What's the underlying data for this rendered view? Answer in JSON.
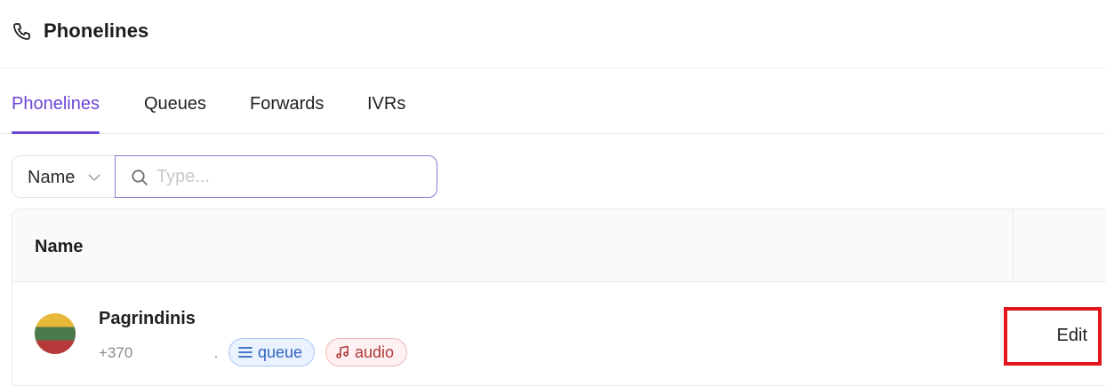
{
  "header": {
    "title": "Phonelines",
    "icon": "phone-icon"
  },
  "tabs": [
    {
      "label": "Phonelines",
      "active": true
    },
    {
      "label": "Queues",
      "active": false
    },
    {
      "label": "Forwards",
      "active": false
    },
    {
      "label": "IVRs",
      "active": false
    }
  ],
  "filter": {
    "field": "Name",
    "search_placeholder": "Type...",
    "search_value": ""
  },
  "table": {
    "columns": [
      "Name"
    ],
    "rows": [
      {
        "name": "Pagrindinis",
        "phone": "+370",
        "flag": "lithuania-flag",
        "tags": [
          {
            "label": "queue",
            "icon": "list-icon"
          },
          {
            "label": "audio",
            "icon": "music-note-icon"
          }
        ],
        "action": "Edit"
      }
    ]
  },
  "colors": {
    "accent": "#6b46d6",
    "queue_tag_bg": "#eaf2ff",
    "queue_tag_text": "#2f64c4",
    "audio_tag_bg": "#fff1f1",
    "audio_tag_text": "#b03a3a",
    "highlight_border": "#e3161b"
  }
}
